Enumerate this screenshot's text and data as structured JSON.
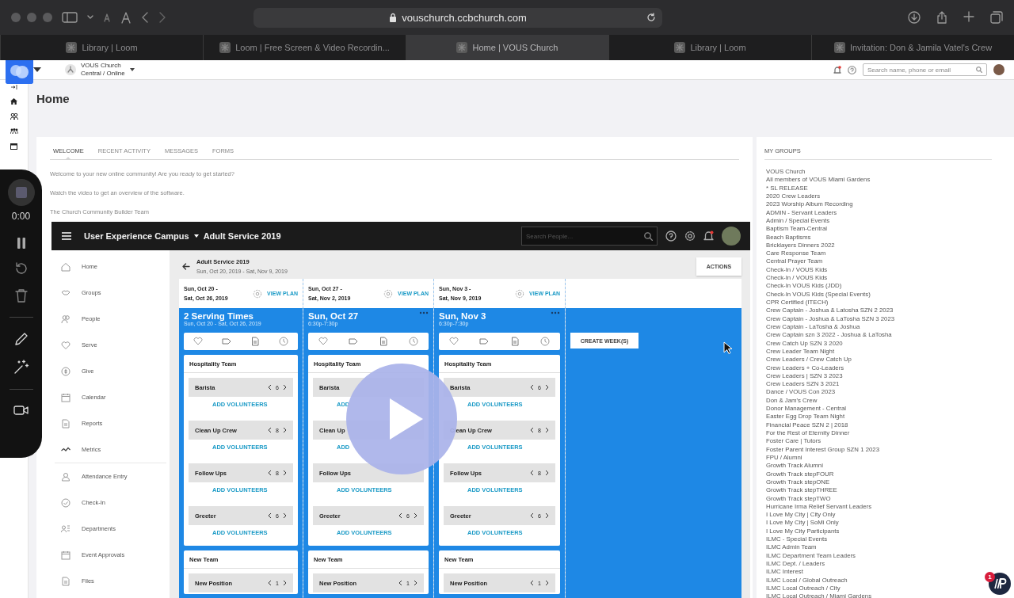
{
  "browser": {
    "url": "vouschurch.ccbchurch.com",
    "tabs": [
      {
        "title": "Library | Loom",
        "selected": false
      },
      {
        "title": "Loom | Free Screen & Video Recordin...",
        "selected": false
      },
      {
        "title": "Home | VOUS Church",
        "selected": true
      },
      {
        "title": "Library | Loom",
        "selected": false
      },
      {
        "title": "Invitation: Don & Jamila Vatel's Crew",
        "selected": false
      }
    ]
  },
  "header": {
    "church": "VOUS Church",
    "campus": "Central / Online",
    "search_placeholder": "Search name, phone or email"
  },
  "page": {
    "title": "Home"
  },
  "welcome": {
    "tabs": [
      {
        "label": "WELCOME",
        "selected": true
      },
      {
        "label": "RECENT ACTIVITY",
        "selected": false
      },
      {
        "label": "MESSAGES",
        "selected": false
      },
      {
        "label": "FORMS",
        "selected": false
      }
    ],
    "paragraphs": [
      "Welcome to your new online community! Are you ready to get started?",
      "Watch the video to get an overview of the software.",
      "The Church Community Builder Team"
    ]
  },
  "video": {
    "app_bar": {
      "campus": "User Experience Campus",
      "service": "Adult Service 2019",
      "search_placeholder": "Search People..."
    },
    "sidebar": [
      {
        "label": "Home"
      },
      {
        "label": "Groups"
      },
      {
        "label": "People"
      },
      {
        "label": "Serve"
      },
      {
        "label": "Give"
      },
      {
        "label": "Calendar"
      },
      {
        "label": "Reports"
      },
      {
        "label": "Metrics"
      },
      {
        "label": "Attendance Entry"
      },
      {
        "label": "Check-In"
      },
      {
        "label": "Departments"
      },
      {
        "label": "Event Approvals"
      },
      {
        "label": "Files"
      }
    ],
    "plan": {
      "title": "Adult Service 2019",
      "range": "Sun, Oct 20, 2019 - Sat, Nov 9, 2019",
      "actions": "ACTIONS",
      "create": "CREATE WEEK(S)",
      "weeks": [
        {
          "start": "Sun, Oct 20 -",
          "end": "Sat, Oct 26, 2019",
          "view_plan": "VIEW PLAN",
          "heading": "2 Serving Times",
          "subheading": "Sun, Oct 20 - Sat, Oct 26, 2019",
          "menu": false,
          "teams": [
            {
              "name": "Hospitality Team",
              "positions": [
                {
                  "name": "Barista",
                  "count": "6",
                  "action": "ADD VOLUNTEERS"
                },
                {
                  "name": "Clean Up Crew",
                  "count": "8",
                  "action": "ADD VOLUNTEERS"
                },
                {
                  "name": "Follow Ups",
                  "count": "8",
                  "action": "ADD VOLUNTEERS"
                },
                {
                  "name": "Greeter",
                  "count": "6",
                  "action": "ADD VOLUNTEERS"
                }
              ]
            },
            {
              "name": "New Team",
              "positions": [
                {
                  "name": "New Position",
                  "count": "1"
                }
              ]
            }
          ]
        },
        {
          "start": "Sun, Oct 27 -",
          "end": "Sat, Nov 2, 2019",
          "view_plan": "VIEW PLAN",
          "heading": "Sun, Oct 27",
          "subheading": "6:30p-7:30p",
          "menu": true,
          "teams": [
            {
              "name": "Hospitality Team",
              "positions": [
                {
                  "name": "Barista",
                  "action": "ADD"
                },
                {
                  "name": "Clean Up",
                  "action": "ADD"
                },
                {
                  "name": "Follow Ups",
                  "action": "ADD VOLUNTEERS"
                },
                {
                  "name": "Greeter",
                  "count": "6",
                  "action": "ADD VOLUNTEERS"
                }
              ]
            },
            {
              "name": "New Team",
              "positions": [
                {
                  "name": "New Position",
                  "count": "1"
                }
              ]
            }
          ]
        },
        {
          "start": "Sun, Nov 3 -",
          "end": "Sat, Nov 9, 2019",
          "view_plan": "VIEW PLAN",
          "heading": "Sun, Nov 3",
          "subheading": "6:30p-7:30p",
          "menu": true,
          "teams": [
            {
              "name": "Hospitality Team",
              "positions": [
                {
                  "name": "Barista",
                  "count": "6",
                  "action": "ADD VOLUNTEERS"
                },
                {
                  "name": "Clean Up Crew",
                  "count": "8",
                  "action": "ADD VOLUNTEERS"
                },
                {
                  "name": "Follow Ups",
                  "count": "8",
                  "action": "ADD VOLUNTEERS"
                },
                {
                  "name": "Greeter",
                  "count": "6",
                  "action": "ADD VOLUNTEERS"
                }
              ]
            },
            {
              "name": "New Team",
              "positions": [
                {
                  "name": "New Position",
                  "count": "1"
                }
              ]
            }
          ]
        }
      ]
    }
  },
  "recorder": {
    "time": "0:00"
  },
  "my_groups": {
    "title": "MY GROUPS",
    "items": [
      "VOUS Church",
      "All members of VOUS Miami Gardens",
      "* SL RELEASE",
      "2020 Crew Leaders",
      "2023 Worship Album Recording",
      "ADMIN - Servant Leaders",
      "Admin / Special Events",
      "Baptism Team-Central",
      "Beach Baptisms",
      "Bricklayers Dinners 2022",
      "Care Response Team",
      "Central Prayer Team",
      "Check-In / VOUS Kids",
      "Check-In / VOUS Kids",
      "Check-In VOUS Kids (JDD)",
      "Check-In VOUS Kids (Special Events)",
      "CPR Certified (ITECH)",
      "Crew Captain - Joshua & Latosha SZN 2 2023",
      "Crew Captain - Joshua & LaTosha SZN 3 2023",
      "Crew Captain - LaTosha & Joshua",
      "Crew Captain szn 3 2022 - Joshua & LaTosha",
      "Crew Catch Up SZN 3 2020",
      "Crew Leader Team Night",
      "Crew Leaders / Crew Catch Up",
      "Crew Leaders + Co-Leaders",
      "Crew Leaders | SZN 3 2023",
      "Crew Leaders SZN 3 2021",
      "Dance / VOUS Con 2023",
      "Don & Jam's Crew",
      "Donor Management - Central",
      "Easter Egg Drop Team Night",
      "Financial Peace SZN 2 | 2018",
      "For the Rest of Eternity Dinner",
      "Foster Care | Tutors",
      "Foster Parent Interest Group SZN 1 2023",
      "FPU / Alumni",
      "Growth Track Alumni",
      "Growth Track stepFOUR",
      "Growth Track stepONE",
      "Growth Track stepTHREE",
      "Growth Track stepTWO",
      "Hurricane Irma Relief Servant Leaders",
      "I Love My City | City Only",
      "I Love My City | SoMi Only",
      "I Love My City Participants",
      "ILMC - Special Events",
      "ILMC Admin Team",
      "ILMC Department Team Leaders",
      "ILMC Dept. / Leaders",
      "ILMC Interest",
      "ILMC Local / Global Outreach",
      "ILMC Local Outreach / City",
      "ILMC Local Outreach / Miami Gardens"
    ]
  },
  "notification": {
    "count": "1"
  }
}
